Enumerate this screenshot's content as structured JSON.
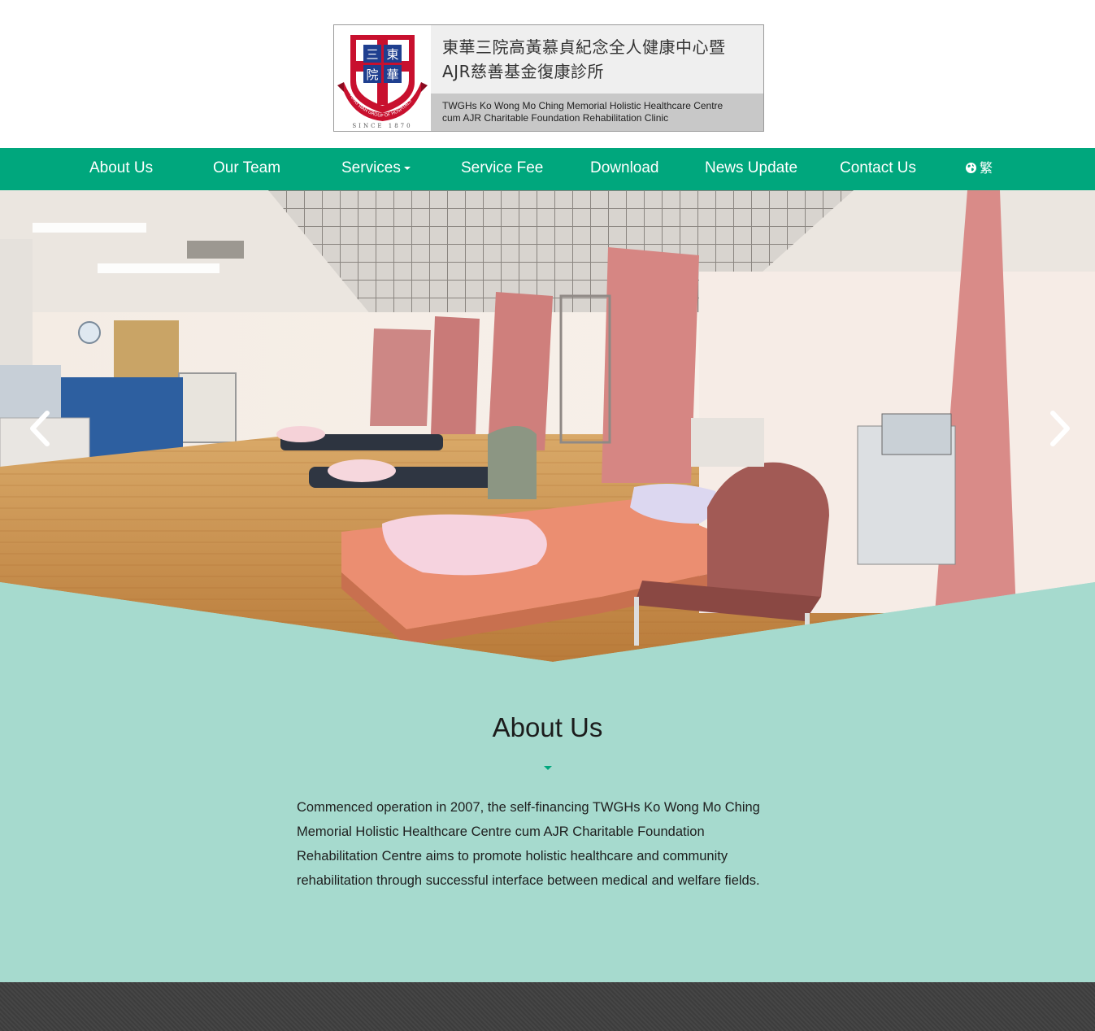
{
  "header": {
    "logo": {
      "emblem_chars": [
        "三",
        "東",
        "院",
        "華"
      ],
      "emblem_ribbon": "TUNG WAH GROUP OF HOSPITALS",
      "emblem_since": "SINCE 1870",
      "title_zh_line1": "東華三院高黃慕貞紀念全人健康中心暨",
      "title_zh_line2": "AJR慈善基金復康診所",
      "title_en_line1": "TWGHs Ko Wong Mo Ching Memorial Holistic Healthcare Centre",
      "title_en_line2": "cum AJR Charitable Foundation Rehabilitation Clinic"
    }
  },
  "nav": {
    "items": [
      {
        "label": "About Us"
      },
      {
        "label": "Our Team"
      },
      {
        "label": "Services",
        "has_dropdown": true
      },
      {
        "label": "Service Fee"
      },
      {
        "label": "Download"
      },
      {
        "label": "News Update"
      },
      {
        "label": "Contact Us"
      }
    ],
    "language": {
      "icon": "globe-icon",
      "label": "繁"
    }
  },
  "hero": {
    "prev_icon": "chevron-left-icon",
    "next_icon": "chevron-right-icon",
    "image_subject": "rehabilitation treatment room"
  },
  "about": {
    "title": "About Us",
    "body": "Commenced operation in 2007, the self-financing TWGHs Ko Wong Mo Ching Memorial Holistic Healthcare Centre cum AJR Charitable Foundation Rehabilitation Centre aims to promote holistic healthcare and community rehabilitation through successful interface between medical and welfare fields."
  },
  "colors": {
    "nav_bg": "#00a77d",
    "about_bg": "#a6dace",
    "footer_bg": "#404040",
    "accent": "#00a77d"
  }
}
